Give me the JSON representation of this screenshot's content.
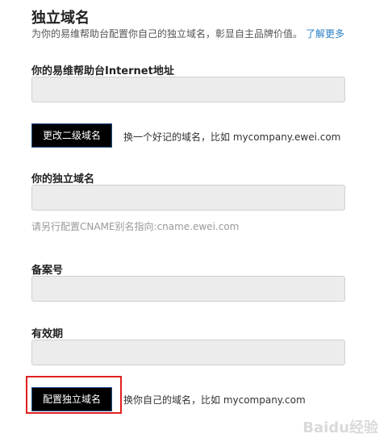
{
  "page": {
    "title": "独立域名",
    "subtitle": "为你的易维帮助台配置你自己的独立域名，彰显自主品牌价值。",
    "learn_more": "了解更多"
  },
  "internet_address": {
    "label": "你的易维帮助台Internet地址",
    "value": "",
    "button_label": "更改二级域名",
    "button_note": "换一个好记的域名，比如 mycompany.ewei.com"
  },
  "custom_domain": {
    "label": "你的独立域名",
    "value": "",
    "hint": "请另行配置CNAME别名指向:cname.ewei.com"
  },
  "record_number": {
    "label": "备案号",
    "value": ""
  },
  "validity": {
    "label": "有效期",
    "value": ""
  },
  "configure": {
    "button_label": "配置独立域名",
    "button_note": "换你自己的域名，比如 mycompany.com"
  },
  "watermark": "Baidu经验",
  "colors": {
    "link": "#2a7fc5",
    "button_bg": "#000000",
    "highlight_border": "#e02020",
    "field_bg": "#ececec"
  }
}
